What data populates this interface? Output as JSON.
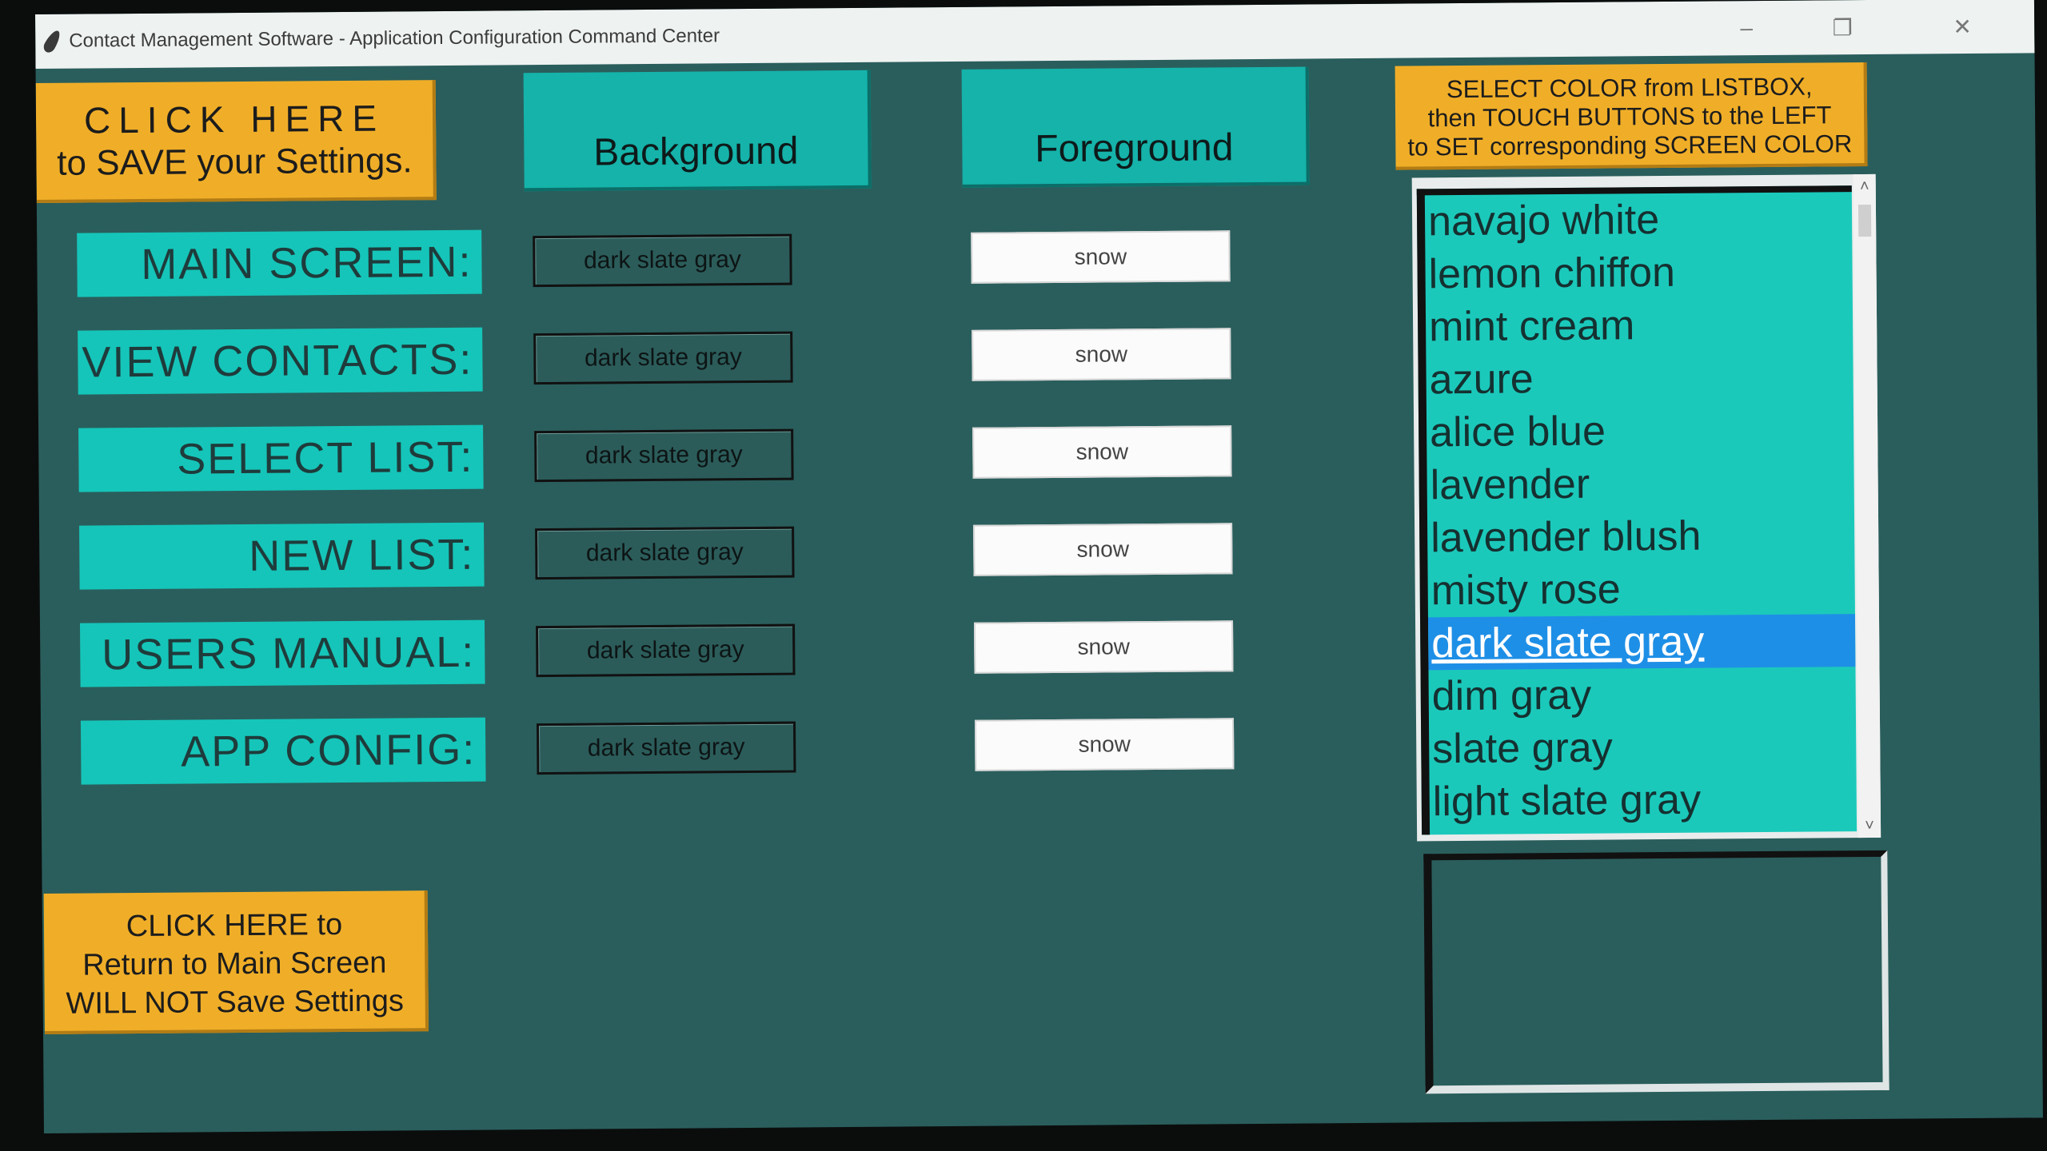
{
  "window": {
    "title": "Contact Management Software - Application Configuration Command Center",
    "controls": {
      "minimize": "–",
      "maximize": "❐",
      "close": "✕"
    }
  },
  "save_button": {
    "line1": "CLICK HERE",
    "line2": "to SAVE your Settings."
  },
  "return_button": {
    "line1": "CLICK HERE to",
    "line2": "Return to Main Screen",
    "line3": "WILL NOT Save Settings"
  },
  "headers": {
    "background": "Background",
    "foreground": "Foreground"
  },
  "instructions": {
    "line1": "SELECT COLOR from LISTBOX,",
    "line2": "then TOUCH BUTTONS to the LEFT",
    "line3": "to SET corresponding SCREEN COLOR"
  },
  "rows": [
    {
      "label": "MAIN SCREEN:",
      "background": "dark slate gray",
      "foreground": "snow"
    },
    {
      "label": "VIEW CONTACTS:",
      "background": "dark slate gray",
      "foreground": "snow"
    },
    {
      "label": "SELECT LIST:",
      "background": "dark slate gray",
      "foreground": "snow"
    },
    {
      "label": "NEW LIST:",
      "background": "dark slate gray",
      "foreground": "snow"
    },
    {
      "label": "USERS MANUAL:",
      "background": "dark slate gray",
      "foreground": "snow"
    },
    {
      "label": "APP CONFIG:",
      "background": "dark slate gray",
      "foreground": "snow"
    }
  ],
  "color_list": {
    "items": [
      "navajo white",
      "lemon chiffon",
      "mint cream",
      "azure",
      "alice blue",
      "lavender",
      "lavender blush",
      "misty rose",
      "dark slate gray",
      "dim gray",
      "slate gray",
      "light slate gray"
    ],
    "selected": "dark slate gray"
  },
  "colors": {
    "window_bg": "#2a5e5c",
    "label_bg": "#15c5b9",
    "orange": "#f0ae28",
    "selection": "#1e8fe6"
  }
}
